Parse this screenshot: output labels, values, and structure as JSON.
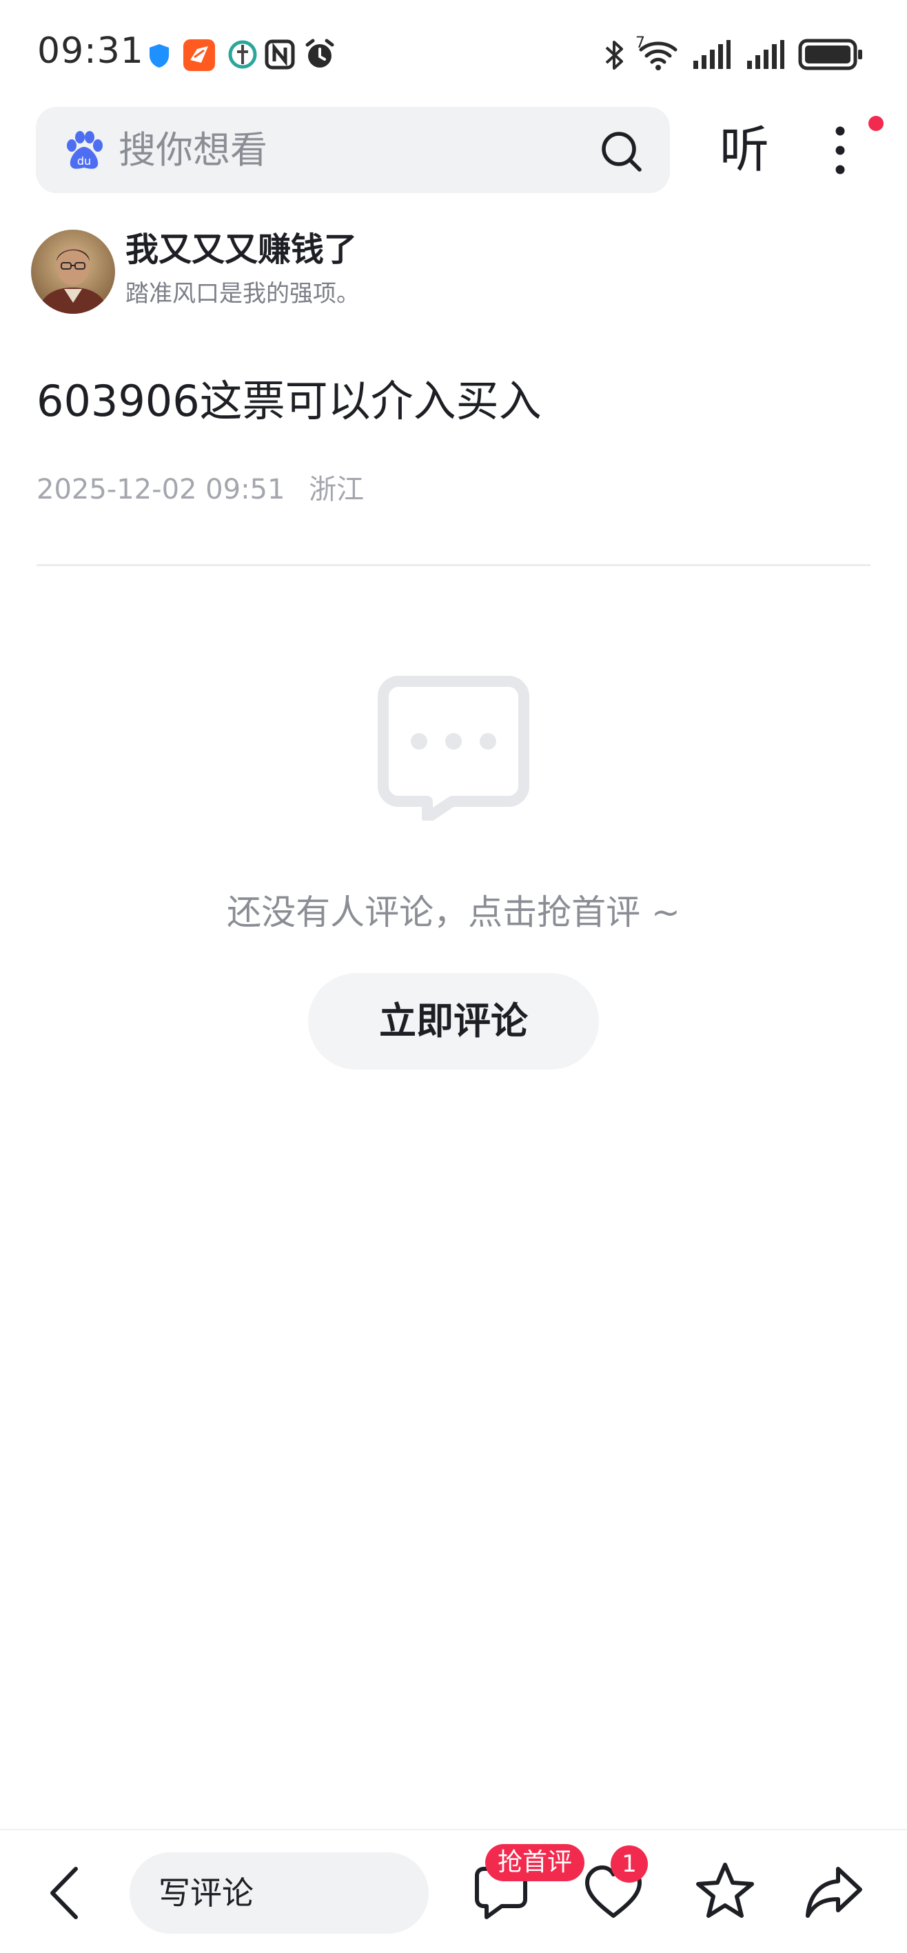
{
  "status_bar": {
    "time": "09:31",
    "icons": [
      "shield-icon",
      "app-notify-icon",
      "leaf-icon",
      "nfc-icon",
      "alarm-icon",
      "bluetooth-icon",
      "wifi-icon",
      "signal-icon",
      "signal-icon",
      "battery-icon"
    ],
    "wifi_label": "7"
  },
  "header": {
    "search_placeholder": "搜你想看",
    "listen_label": "听",
    "has_notification": true,
    "accent_color": "#f22a4e"
  },
  "author": {
    "name": "我又又又赚钱了",
    "bio": "踏准风口是我的强项。"
  },
  "post": {
    "title": "603906这票可以介入买入",
    "date": "2025-12-02 09:51",
    "location": "浙江"
  },
  "comments": {
    "empty_text": "还没有人评论，点击抢首评 ~",
    "comment_now_label": "立即评论"
  },
  "bottom_bar": {
    "write_comment_placeholder": "写评论",
    "first_comment_badge": "抢首评",
    "like_count": "1"
  }
}
